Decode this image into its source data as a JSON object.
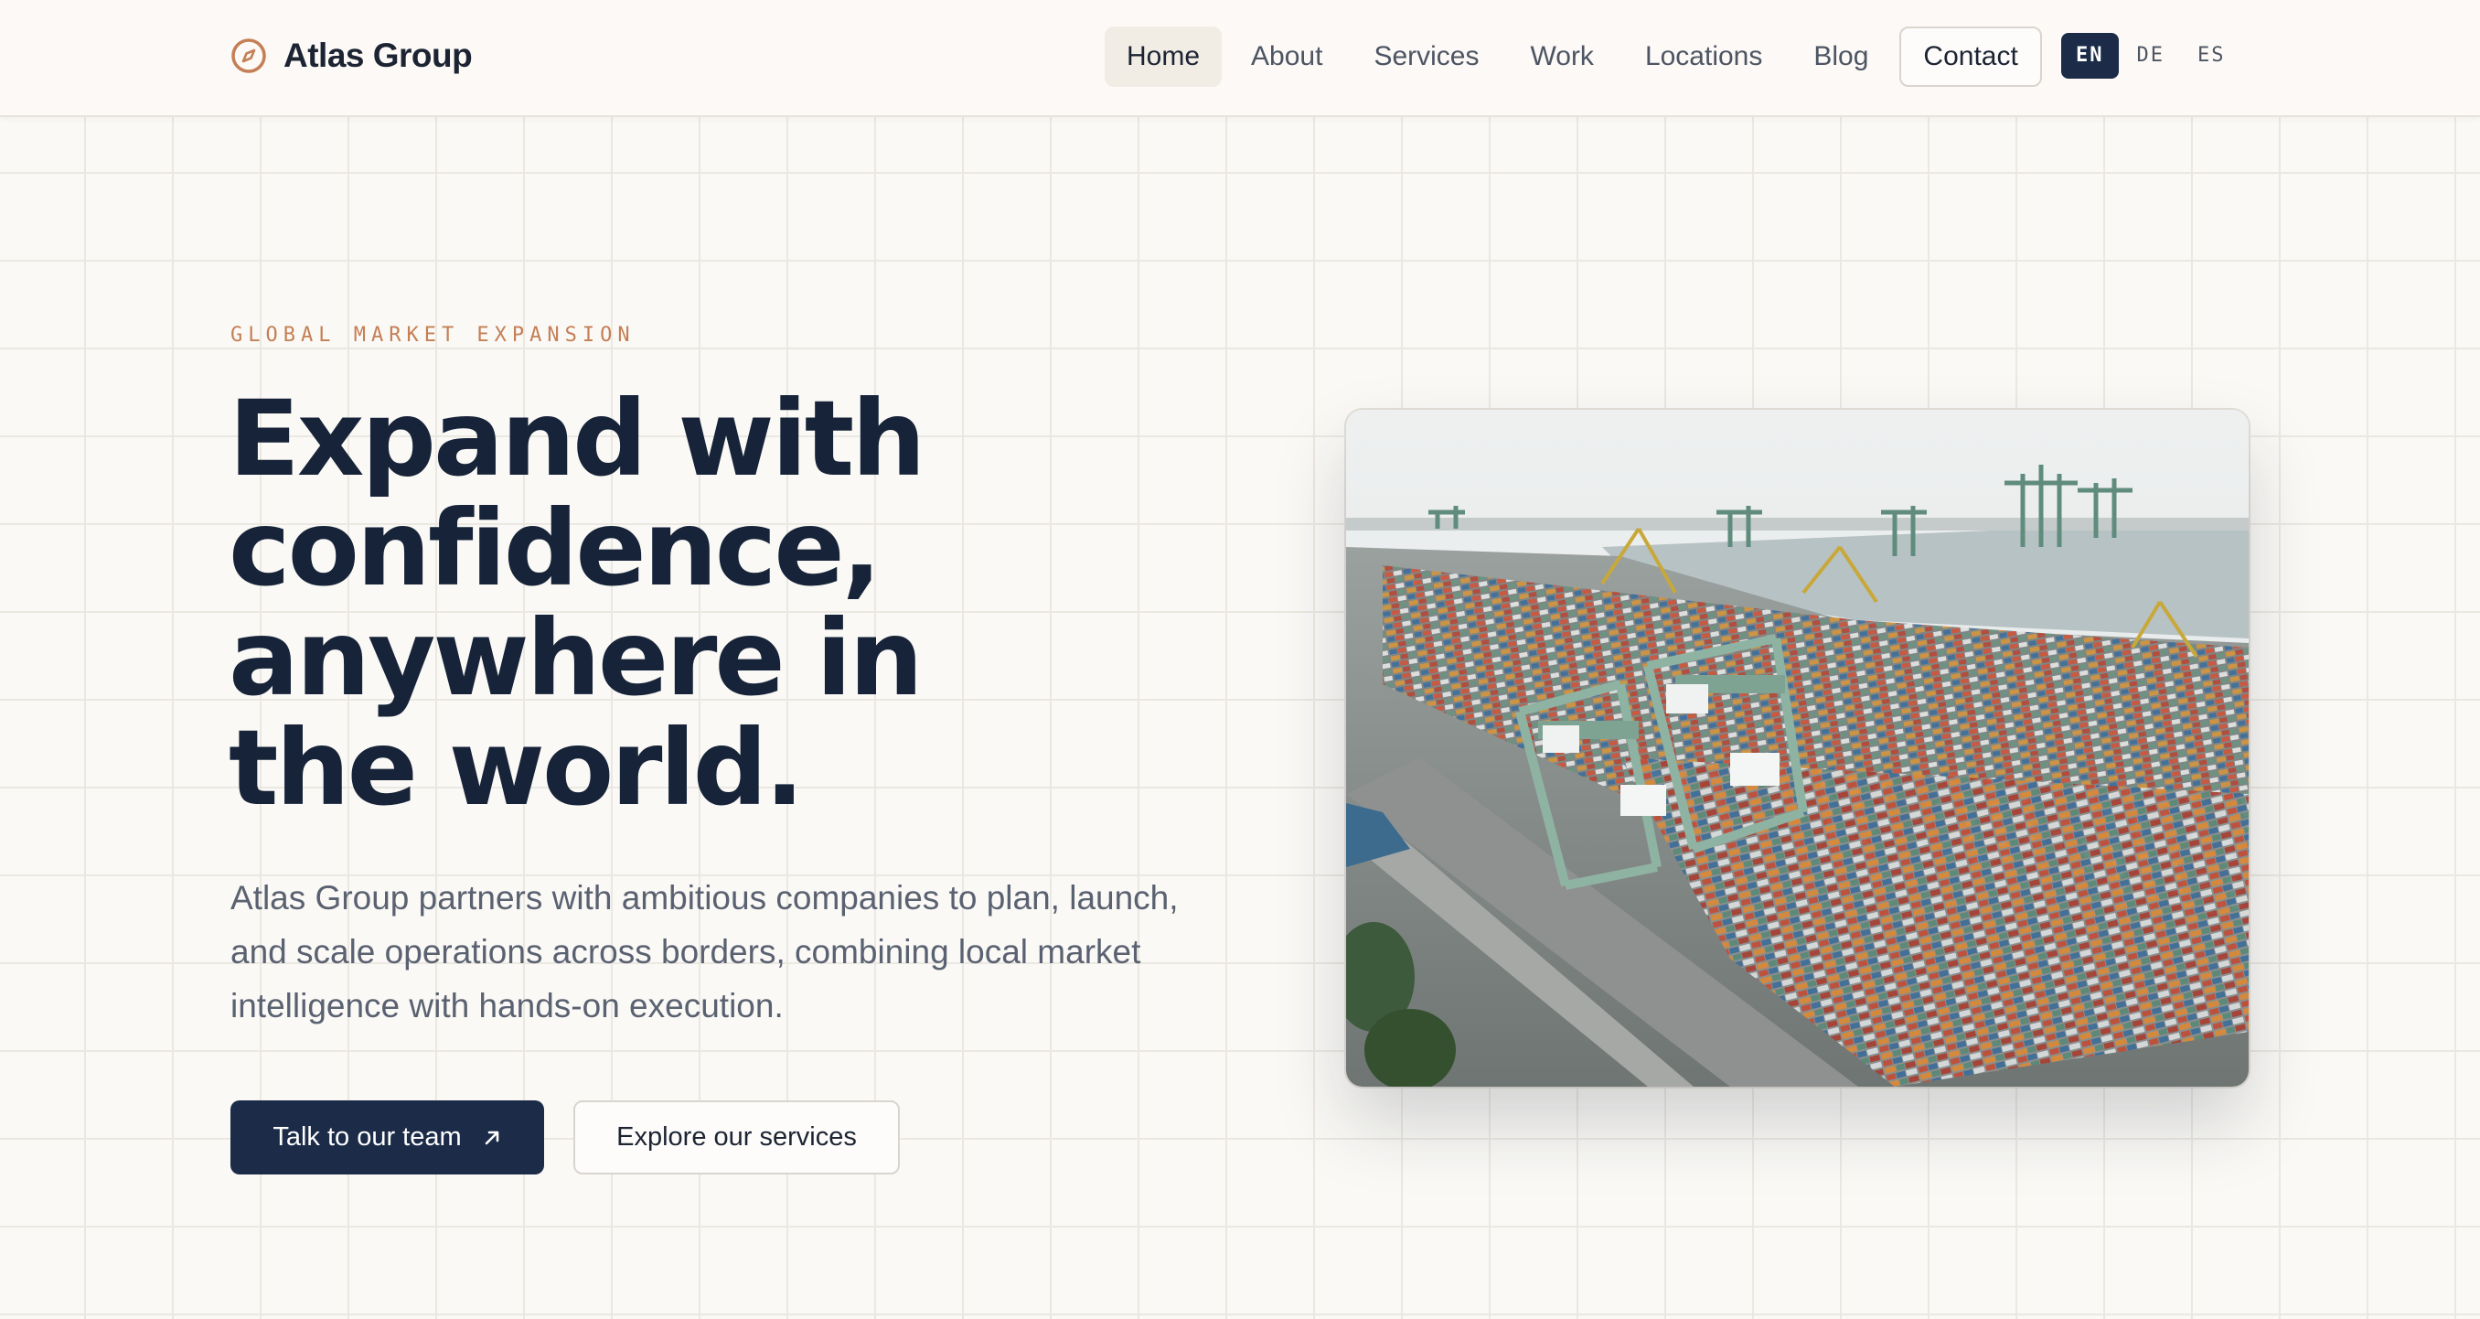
{
  "brand": {
    "name": "Atlas Group",
    "icon": "compass-icon",
    "accent": "#c47f55"
  },
  "nav": {
    "items": [
      {
        "label": "Home",
        "active": true
      },
      {
        "label": "About"
      },
      {
        "label": "Services"
      },
      {
        "label": "Work"
      },
      {
        "label": "Locations"
      },
      {
        "label": "Blog"
      }
    ],
    "contact_label": "Contact"
  },
  "languages": {
    "items": [
      "EN",
      "DE",
      "ES"
    ],
    "selected": "EN"
  },
  "hero": {
    "eyebrow": "GLOBAL MARKET EXPANSION",
    "headline_lines": [
      "Expand with",
      "confidence,",
      "anywhere in",
      "the world."
    ],
    "lead": "Atlas Group partners with ambitious companies to plan, launch, and scale operations across borders, combining local market intelligence with hands-on execution.",
    "primary_cta": "Talk to our team",
    "secondary_cta": "Explore our services",
    "image_subject": "aerial view of container port with cranes"
  },
  "colors": {
    "navy": "#1b2b48",
    "accent": "#c47f55",
    "background": "#faf9f6"
  }
}
